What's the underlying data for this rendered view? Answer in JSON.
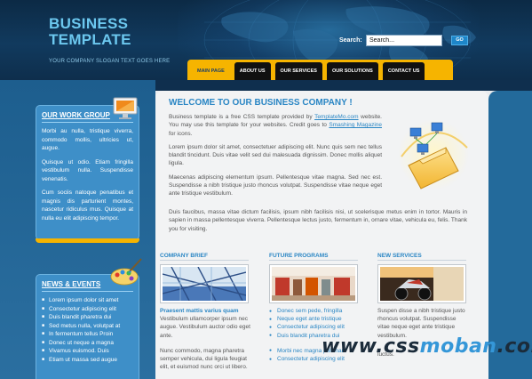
{
  "header": {
    "title_line1": "BUSINESS",
    "title_line2": "TEMPLATE",
    "slogan": "YOUR COMPANY SLOGAN TEXT GOES HERE",
    "search_label": "Search:",
    "search_value": "Search...",
    "go_label": "GO"
  },
  "nav": {
    "items": [
      "MAIN PAGE",
      "ABOUT US",
      "OUR SERVICES",
      "OUR SOLUTIONS",
      "CONTACT US"
    ],
    "active_index": 0
  },
  "sidebar": {
    "work_group": {
      "title": "OUR WORK GROUP",
      "p1": "Morbi au nulla, tristique viverra, commodo mollis, ultricies ut, augue.",
      "p2": "Quisque ut odio. Etiam fringilla vestibulum nulla. Suspendisse venenatis.",
      "p3": "Cum sociis natoque penatibus et magnis dis parturient montes, nascetur ridiculus mus. Quisque at nulla eu elit adipiscing tempor."
    },
    "news": {
      "title": "NEWS & EVENTS",
      "items": [
        "Lorem ipsum dolor sit amet",
        "Consectetur adipiscing elit",
        "Duis blandit pharetra dui",
        "Sed metus nulla, volutpat at",
        "In fermentum tellus Proin",
        "Donec ut neque a magna",
        "Vivamus euismod. Duis",
        "Etiam ut massa sed augue"
      ]
    }
  },
  "main": {
    "welcome": "WELCOME TO OUR BUSINESS COMPANY !",
    "intro_pre": "Business template is a free CSS template provided by ",
    "intro_link1": "TemplateMo.com",
    "intro_mid": " website. You may use this template for your websites. Credit goes to ",
    "intro_link2": "Smashing Magazine",
    "intro_post": " for icons.",
    "p2": "Lorem ipsum dolor sit amet, consectetuer adipiscing elit. Nunc quis sem nec tellus blandit tincidunt. Duis vitae velit sed dui malesuada dignissim. Donec mollis aliquet ligula.",
    "p3": "Maecenas adipiscing elementum ipsum. Pellentesque vitae magna. Sed nec est. Suspendisse a nibh tristique justo rhoncus volutpat. Suspendisse vitae neque eget ante tristique vestibulum.",
    "p4": "Duis faucibus, massa vitae dictum facilisis, ipsum nibh facilisis nisi, ut scelerisque metus enim in tortor. Mauris in sapien in massa pellentesque viverra. Pellentesque lectus justo, fermentum in, ornare vitae, vehicula eu, felis. Thank you for visiting."
  },
  "columns": {
    "brief": {
      "title": "COMPANY BRIEF",
      "subtitle": "Praesent mattis varius quam",
      "p1": "Vestibulum ullamcorper ipsum nec augue. Vestibulum auctor odio eget ante.",
      "p2": "Nunc commodo, magna pharetra semper vehicula, dui ligula feugiat elit, et euismod nunc orci ut libero."
    },
    "future": {
      "title": "FUTURE PROGRAMS",
      "items": [
        "Donec sem pede, fringilla",
        "Neque eget ante tristique",
        "Consectetur adipiscing elit",
        "Duis blandit pharetra dui",
        "Morbi nec magna pulvinar",
        "Consectetur adipiscing elit"
      ]
    },
    "news_services": {
      "title": "NEW SERVICES",
      "p1": "Suspen disse a nibh tristique justo rhoncus volutpat. Suspendisse vitae neque eget ante tristique vestibulum.",
      "p2": "luctus."
    }
  },
  "watermark": {
    "pre": "www.css",
    "blue": "moban",
    "post": ".com"
  },
  "colors": {
    "accent_blue": "#2a86c4",
    "nav_yellow": "#f6b400",
    "header_dark": "#0c2a45",
    "sidebar_box": "#3e8fc8"
  }
}
